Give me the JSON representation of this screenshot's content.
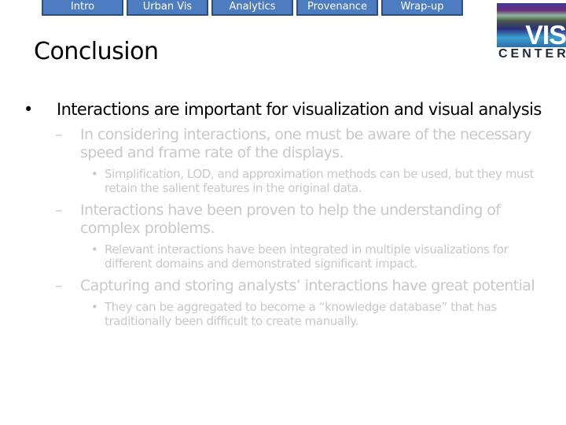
{
  "nav": {
    "tabs": [
      {
        "label": "Intro"
      },
      {
        "label": "Urban Vis"
      },
      {
        "label": "Analytics"
      },
      {
        "label": "Provenance"
      },
      {
        "label": "Wrap-up"
      }
    ]
  },
  "logo": {
    "top": "VIS",
    "bottom": "CENTER"
  },
  "slide": {
    "title": "Conclusion",
    "bullet": "Interactions are important for visualization and visual analysis",
    "subpoints": [
      {
        "text": "In considering interactions, one must be aware of the necessary speed and frame rate of the displays.",
        "detail": "Simplification, LOD, and approximation methods can be used, but they must retain the salient features in the original data."
      },
      {
        "text": "Interactions have been proven to help the understanding of complex problems.",
        "detail": "Relevant interactions have been integrated in multiple visualizations for different domains and demonstrated significant impact."
      },
      {
        "text": "Capturing and storing analysts’ interactions have great potential",
        "detail": "They can be aggregated to become a “knowledge database” that has traditionally been difficult to create manually."
      }
    ],
    "bullet_glyph": "•",
    "dash_glyph": "–"
  },
  "colors": {
    "tab_fill": "#4d7dc0",
    "tab_border": "#2c4e7e",
    "faded_text": "#c8c8c8"
  }
}
